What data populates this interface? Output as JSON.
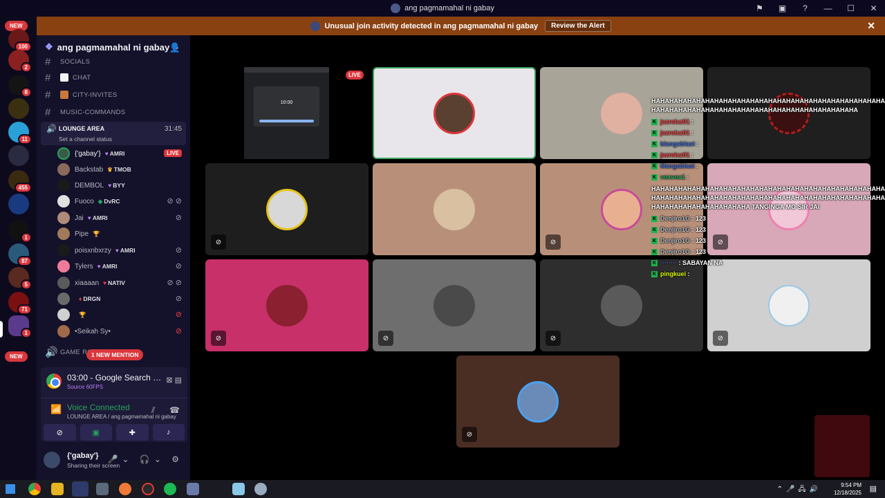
{
  "window": {
    "title": "ang pagmamahal ni gabay"
  },
  "alert": {
    "text": "Unusual join activity detected in ang pagmamahal ni gabay",
    "action": "Review the Alert"
  },
  "rail": {
    "top_pill": "NEW",
    "bottom_pill": "NEW",
    "badges": [
      "100",
      "2",
      "8",
      "11",
      "455",
      "1",
      "87",
      "5",
      "71",
      "1"
    ]
  },
  "guild": {
    "name": "ang pagmamahal ni gabay"
  },
  "channels": [
    {
      "name": "SOCIALS"
    },
    {
      "name": "CHAT"
    },
    {
      "name": "CITY-INVITES"
    },
    {
      "name": "MUSIC-COMMANDS"
    }
  ],
  "voice_channel": {
    "name": "LOUNGE AREA",
    "time": "31:45",
    "status": "Set a channel status"
  },
  "members": [
    {
      "name": "{'gabay'}",
      "tag": "AMRI",
      "live": "LIVE"
    },
    {
      "name": "Backstab",
      "tag": "TMOB"
    },
    {
      "name": "DEMBOL",
      "tag": "BYY"
    },
    {
      "name": "Fuoco",
      "tag": "DvRC"
    },
    {
      "name": "Jai",
      "tag": "AMRI"
    },
    {
      "name": "Pipe",
      "tag": ""
    },
    {
      "name": "poisxnbxrzy",
      "tag": "AMRI"
    },
    {
      "name": "Tylers",
      "tag": "AMRI"
    },
    {
      "name": "xiaaaan",
      "tag": "NATIV"
    },
    {
      "name": "",
      "tag": "DRGN"
    },
    {
      "name": "",
      "tag": ""
    },
    {
      "name": "•Seikah Sy•",
      "tag": ""
    }
  ],
  "next_channel": {
    "name": "GAME RO",
    "mention": "1 NEW MENTION"
  },
  "activity": {
    "title": "03:00 - Google Search - Googl...",
    "sub": "Source 60FPS"
  },
  "voice": {
    "status": "Voice Connected",
    "location": "LOUNGE AREA / ang pagmamahal ni gabay"
  },
  "user": {
    "name": "{'gabay'}",
    "status": "Sharing their screen"
  },
  "stage": {
    "live_label": "LIVE",
    "stream_timer": "10:00"
  },
  "chat": {
    "lines": [
      {
        "user": "",
        "text": "HAHAHAHAHAHAHAHAHAHAHAHAHAHAHAHAHAHAHAHAHAHAHAHAHAHAHAHAHAHAHAHAHAHAHAHAHAHAHAHAHAHAHAHAHAHAHAHAHA"
      },
      {
        "user": "jezrelxz01",
        "text": ""
      },
      {
        "user": "jezrelxz01",
        "text": ""
      },
      {
        "user": "blangablast",
        "text": ""
      },
      {
        "user": "jezrelxz01",
        "text": ""
      },
      {
        "user": "Mangablast",
        "text": ""
      },
      {
        "user": "voxvox1",
        "text": ""
      },
      {
        "user": "",
        "text": "HAHAHAHAHAHAHAHAHAHAHAHAHAHAHAHAHAHAHAHAHAHAHAHAHAHAHAHAHAHAHAHAHAHAHAHAHAHAHAHAHAHAHAHAHAHAHAHAHAHAHAHAHAHAHAHAHAHAHAHAHAHAHA TANGINGA MO SIR JAI"
      },
      {
        "user": "Denjiro1G",
        "text": "123"
      },
      {
        "user": "Denjiro1G",
        "text": "123"
      },
      {
        "user": "Denjiro1G",
        "text": "123"
      },
      {
        "user": "Denjiro1G",
        "text": "123"
      },
      {
        "user": "",
        "text": "SABAYAN NA"
      },
      {
        "user": "pingkuei",
        "text": ""
      }
    ]
  },
  "taskbar": {
    "time": "9:54 PM",
    "date": "12/18/2025"
  }
}
